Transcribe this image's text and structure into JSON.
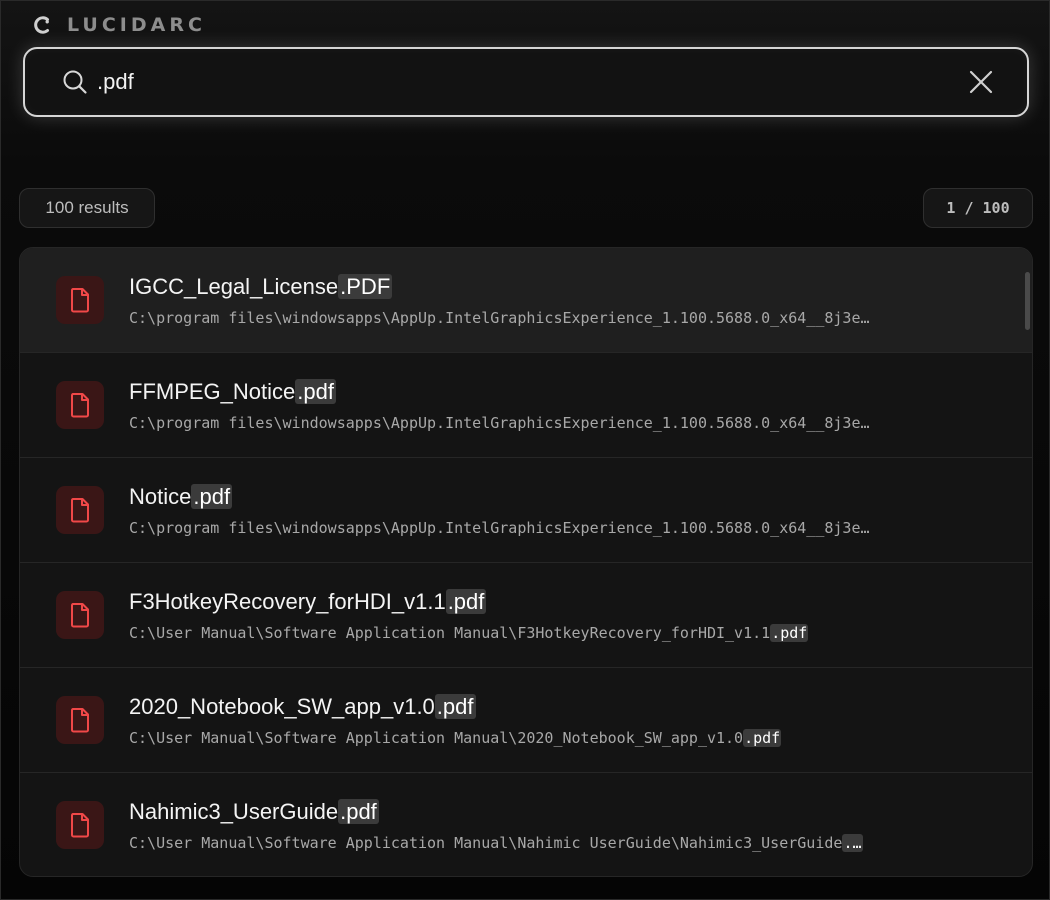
{
  "brand": {
    "name": "LUCIDARC",
    "logo_icon": "crescent-logo-icon"
  },
  "search": {
    "value": ".pdf",
    "placeholder": "",
    "icon": "search-icon",
    "clear_icon": "close-icon"
  },
  "results_count": "100 results",
  "page_indicator": "1 / 100",
  "colors": {
    "accent_file_icon": "#f04848",
    "file_icon_bg": "#3a1616",
    "highlight_bg": "#3b3b3b"
  },
  "results": [
    {
      "name_base": "IGCC_Legal_License",
      "name_match": ".PDF",
      "path_base": "C:\\program files\\windowsapps\\AppUp.IntelGraphicsExperience_1.100.5688.0_x64__8j3e…",
      "path_match": "",
      "selected": true
    },
    {
      "name_base": "FFMPEG_Notice",
      "name_match": ".pdf",
      "path_base": "C:\\program files\\windowsapps\\AppUp.IntelGraphicsExperience_1.100.5688.0_x64__8j3e…",
      "path_match": "",
      "selected": false
    },
    {
      "name_base": "Notice",
      "name_match": ".pdf",
      "path_base": "C:\\program files\\windowsapps\\AppUp.IntelGraphicsExperience_1.100.5688.0_x64__8j3e…",
      "path_match": "",
      "selected": false
    },
    {
      "name_base": "F3HotkeyRecovery_forHDI_v1.1",
      "name_match": ".pdf",
      "path_base": "C:\\User Manual\\Software Application Manual\\F3HotkeyRecovery_forHDI_v1.1",
      "path_match": ".pdf",
      "selected": false
    },
    {
      "name_base": "2020_Notebook_SW_app_v1.0",
      "name_match": ".pdf",
      "path_base": "C:\\User Manual\\Software Application Manual\\2020_Notebook_SW_app_v1.0",
      "path_match": ".pdf",
      "selected": false
    },
    {
      "name_base": "Nahimic3_UserGuide",
      "name_match": ".pdf",
      "path_base": "C:\\User Manual\\Software Application Manual\\Nahimic UserGuide\\Nahimic3_UserGuide",
      "path_match": ".…",
      "selected": false
    }
  ]
}
